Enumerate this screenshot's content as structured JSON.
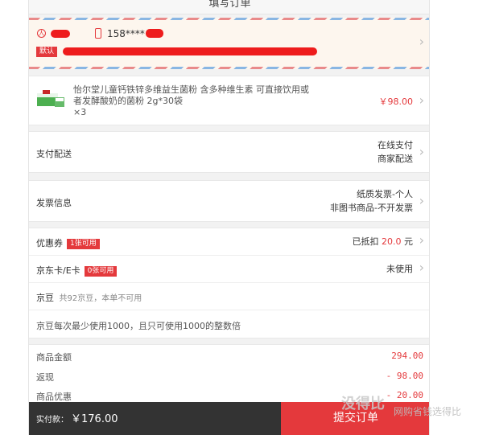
{
  "header": {
    "title": "填写订单"
  },
  "address": {
    "phone": "158****",
    "default_badge": "默认"
  },
  "product": {
    "name": "怡尔堂儿童钙铁锌多维益生菌粉 含多种维生素 可直接饮用或者发酵酸奶的菌粉 2g*30袋",
    "quantity": "×3",
    "price": "￥98.00"
  },
  "payment": {
    "label": "支付配送",
    "method": "在线支付",
    "delivery": "商家配送"
  },
  "invoice": {
    "label": "发票信息",
    "type": "纸质发票-个人",
    "content": "非图书商品-不开发票"
  },
  "coupon": {
    "label": "优惠券",
    "tag": "1张可用",
    "value_prefix": "已抵扣",
    "value": "20.0",
    "value_suffix": "元"
  },
  "ecard": {
    "label": "京东卡/E卡",
    "tag": "0张可用",
    "value": "未使用"
  },
  "jingdou": {
    "label": "京豆",
    "note": "共92京豆，本单不可用",
    "rule": "京豆每次最少使用1000，且只可使用1000的整数倍"
  },
  "summary": [
    {
      "label": "商品金额",
      "value": "294.00"
    },
    {
      "label": "返现",
      "value": "- 98.00"
    },
    {
      "label": "商品优惠",
      "value": "- 20.00"
    }
  ],
  "footer": {
    "total_label": "实付款：",
    "total_value": "￥176.00",
    "submit_label": "提交订单"
  },
  "watermark": {
    "main": "没得比",
    "sub": "网购省钱选得比"
  }
}
